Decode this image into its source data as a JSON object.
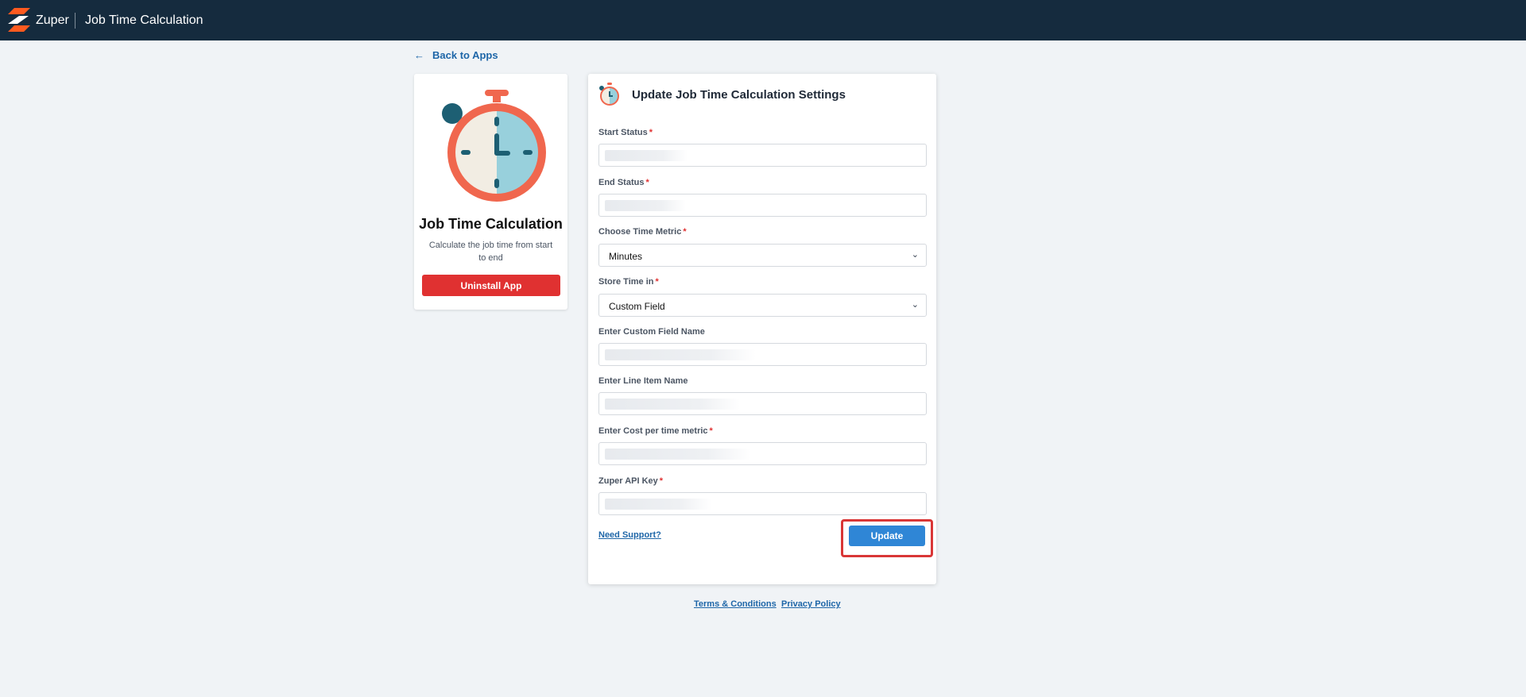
{
  "header": {
    "brand": "Zuper",
    "app_title": "Job Time Calculation"
  },
  "nav": {
    "back_label": "Back to Apps",
    "back_icon": "arrow-left-icon"
  },
  "app_card": {
    "icon": "stopwatch-icon",
    "name": "Job Time Calculation",
    "description": "Calculate the job time from start to end",
    "uninstall_label": "Uninstall App"
  },
  "form": {
    "title": "Update Job Time Calculation Settings",
    "required_mark": "*",
    "fields": [
      {
        "label": "Start Status",
        "required": true,
        "type": "text",
        "value": ""
      },
      {
        "label": "End Status",
        "required": true,
        "type": "text",
        "value": ""
      },
      {
        "label": "Choose Time Metric",
        "required": true,
        "type": "select",
        "value": "Minutes"
      },
      {
        "label": "Store Time in",
        "required": true,
        "type": "select",
        "value": "Custom Field"
      },
      {
        "label": "Enter Custom Field Name",
        "required": false,
        "type": "text",
        "value": ""
      },
      {
        "label": "Enter Line Item Name",
        "required": false,
        "type": "text",
        "value": ""
      },
      {
        "label": "Enter Cost per time metric",
        "required": true,
        "type": "text",
        "value": ""
      },
      {
        "label": "Zuper API Key",
        "required": true,
        "type": "text",
        "value": ""
      }
    ],
    "support_label": "Need Support?",
    "submit_label": "Update"
  },
  "footer": {
    "terms": "Terms & Conditions",
    "privacy": "Privacy Policy"
  },
  "colors": {
    "topbar": "#152b3e",
    "primary": "#2f86d6",
    "danger": "#e03131",
    "link": "#1e66a8"
  }
}
